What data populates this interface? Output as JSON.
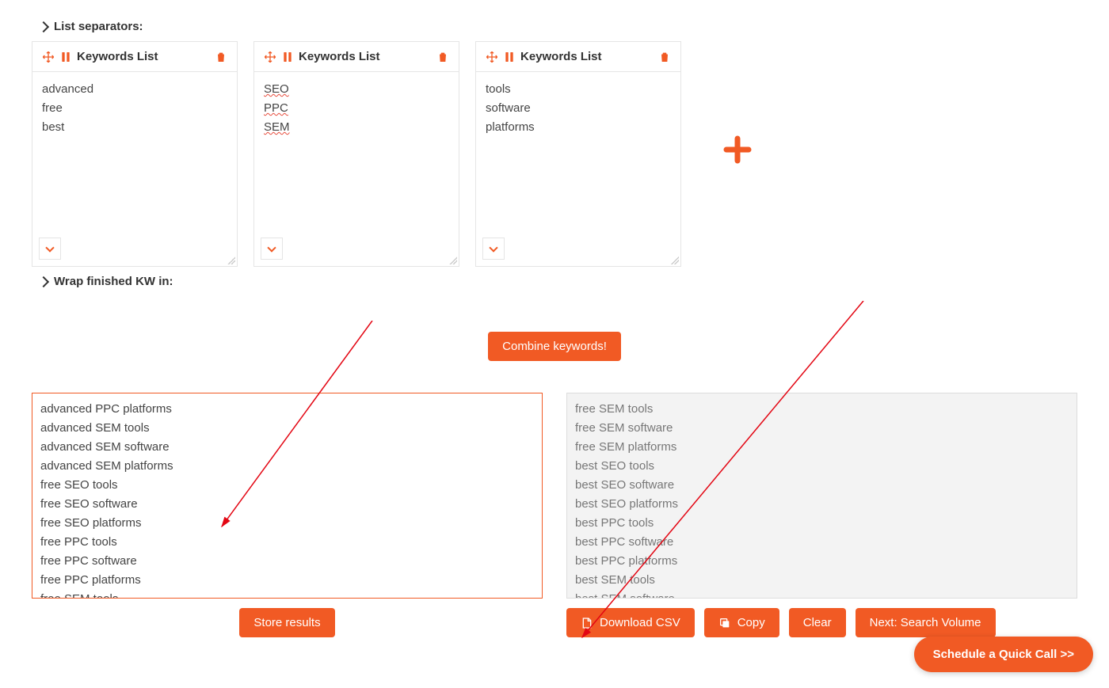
{
  "sections": {
    "list_separators": "List separators:",
    "wrap_in": "Wrap finished KW in:"
  },
  "card_title": "Keywords List",
  "lists": [
    {
      "lines": [
        "advanced",
        "free",
        "best"
      ],
      "spellcheck": false
    },
    {
      "lines": [
        "SEO",
        "PPC",
        "SEM"
      ],
      "spellcheck": true
    },
    {
      "lines": [
        "tools",
        "software",
        "platforms"
      ],
      "spellcheck": false
    }
  ],
  "buttons": {
    "combine": "Combine keywords!",
    "store": "Store results",
    "download": "Download CSV",
    "copy": "Copy",
    "clear": "Clear",
    "next": "Next: Search Volume",
    "call": "Schedule a Quick Call >>"
  },
  "results_left": [
    "advanced PPC platforms",
    "advanced SEM tools",
    "advanced SEM software",
    "advanced SEM platforms",
    "free SEO tools",
    "free SEO software",
    "free SEO platforms",
    "free PPC tools",
    "free PPC software",
    "free PPC platforms",
    "free SEM tools"
  ],
  "results_right": [
    "free SEM tools",
    "free SEM software",
    "free SEM platforms",
    "best SEO tools",
    "best SEO software",
    "best SEO platforms",
    "best PPC tools",
    "best PPC software",
    "best PPC platforms",
    "best SEM tools",
    "best SEM software"
  ]
}
